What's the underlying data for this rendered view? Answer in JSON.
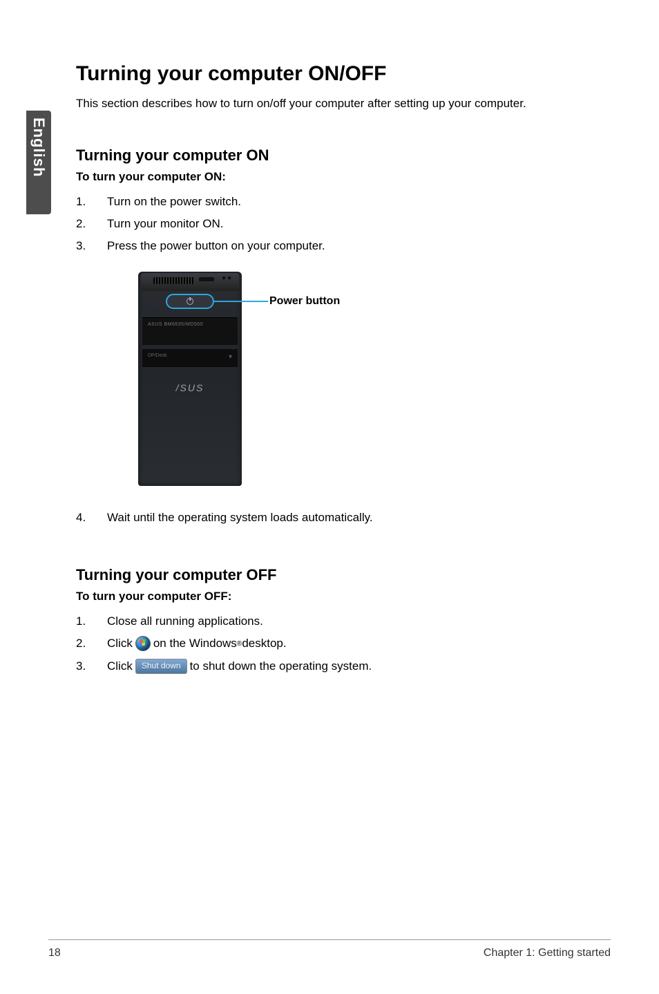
{
  "side_tab": "English",
  "title": "Turning your computer ON/OFF",
  "intro": "This section describes how to turn on/off your computer after setting up your computer.",
  "on": {
    "heading": "Turning your computer ON",
    "lead": "To turn your computer ON:",
    "steps": {
      "s1": {
        "n": "1.",
        "t": "Turn on the power switch."
      },
      "s2": {
        "n": "2.",
        "t": "Turn your monitor ON."
      },
      "s3": {
        "n": "3.",
        "t": "Press the power button on your computer."
      },
      "s4": {
        "n": "4.",
        "t": "Wait until the operating system loads automatically."
      }
    }
  },
  "figure": {
    "callout": "Power button",
    "brand1": "ASUS BM6635/MD560",
    "brand2": "DP/Desk",
    "logo": "/SUS"
  },
  "off": {
    "heading": "Turning your computer OFF",
    "lead": "To turn your computer OFF:",
    "steps": {
      "s1": {
        "n": "1.",
        "t": "Close all running applications."
      },
      "s2": {
        "n": "2.",
        "pre": "Click ",
        "post_a": " on the Windows",
        "post_b": " desktop."
      },
      "s3": {
        "n": "3.",
        "pre": "Click ",
        "btn": "Shut down",
        "post": " to shut down the operating system."
      }
    }
  },
  "footer": {
    "page": "18",
    "chapter": "Chapter 1: Getting started"
  }
}
